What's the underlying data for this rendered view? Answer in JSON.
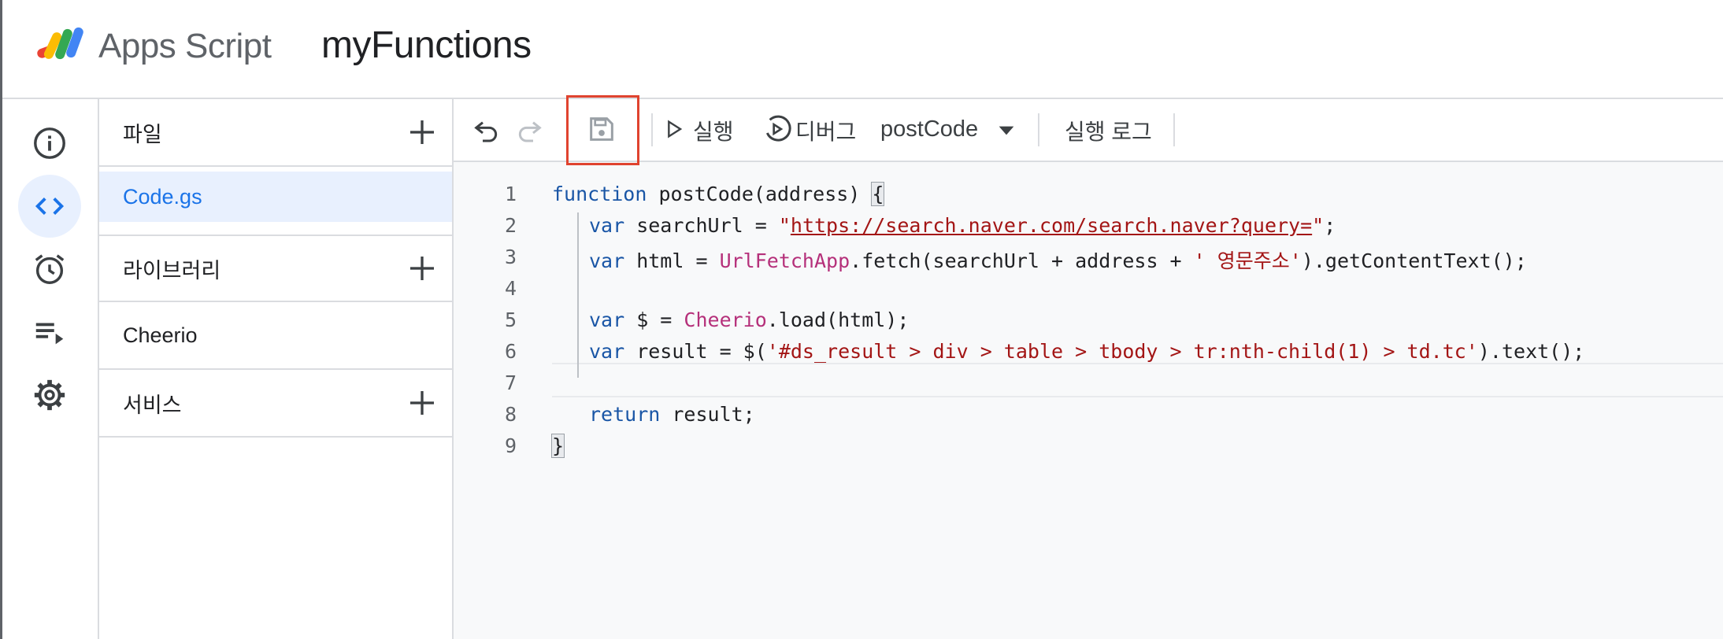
{
  "header": {
    "app_name": "Apps Script",
    "project_title": "myFunctions"
  },
  "rail": {
    "items": [
      {
        "icon": "info-icon"
      },
      {
        "icon": "code-icon",
        "active": true
      },
      {
        "icon": "alarm-clock-icon"
      },
      {
        "icon": "playlist-run-icon"
      },
      {
        "icon": "gear-icon"
      }
    ]
  },
  "files_panel": {
    "files_label": "파일",
    "file_name": "Code.gs",
    "libraries_label": "라이브러리",
    "library_name": "Cheerio",
    "services_label": "서비스"
  },
  "toolbar": {
    "run_label": "실행",
    "debug_label": "디버그",
    "function_select": "postCode",
    "exec_log_label": "실행 로그"
  },
  "code": {
    "line_numbers": [
      "1",
      "2",
      "3",
      "4",
      "5",
      "6",
      "7",
      "8",
      "9"
    ],
    "l1_kw": "function",
    "l1_rest": " postCode(address) ",
    "l1_brace": "{",
    "l2_kw": "var",
    "l2_mid": " searchUrl = ",
    "l2_q1": "\"",
    "l2_url": "https://search.naver.com/search.naver?query=",
    "l2_q2": "\"",
    "l2_end": ";",
    "l3_kw": "var",
    "l3_mid": " html = ",
    "l3_cls": "UrlFetchApp",
    "l3_call": ".fetch(searchUrl + address + ",
    "l3_str": "' 영문주소'",
    "l3_end": ").getContentText();",
    "l5_kw": "var",
    "l5_mid": " $ = ",
    "l5_cls": "Cheerio",
    "l5_end": ".load(html);",
    "l6_kw": "var",
    "l6_mid": " result = $(",
    "l6_str": "'#ds_result > div > table > tbody > tr:nth-child(1) > td.tc'",
    "l6_end": ").text();",
    "l8_kw": "return",
    "l8_end": " result;",
    "l9_brace": "}"
  },
  "colors": {
    "accent": "#1a73e8",
    "highlight_box": "#e0432f",
    "keyword": "#1a56a6",
    "string": "#a31515",
    "class": "#b5307a"
  }
}
